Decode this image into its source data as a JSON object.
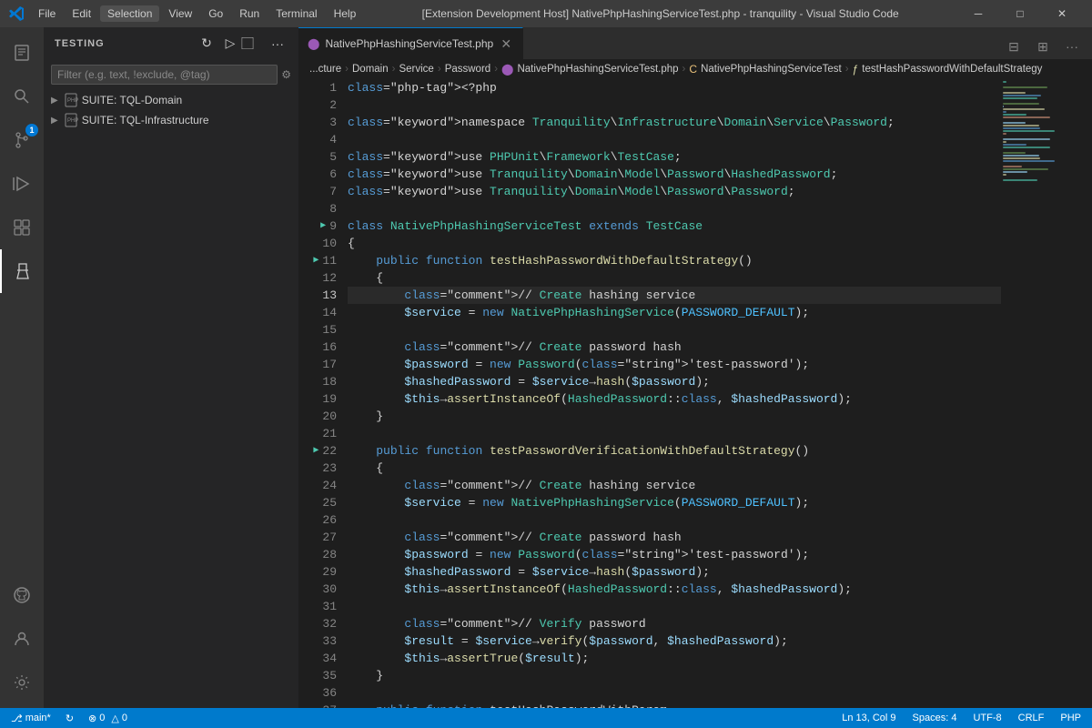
{
  "titlebar": {
    "title": "[Extension Development Host] NativePhpHashingServiceTest.php - tranquility - Visual Studio Code",
    "menu_items": [
      "File",
      "Edit",
      "Selection",
      "View",
      "Go",
      "Run",
      "Terminal",
      "Help"
    ],
    "controls": [
      "─",
      "□",
      "✕"
    ]
  },
  "activitybar": {
    "icons": [
      {
        "name": "explorer-icon",
        "symbol": "⎘",
        "active": false
      },
      {
        "name": "search-icon",
        "symbol": "🔍",
        "active": false
      },
      {
        "name": "source-control-icon",
        "symbol": "⑂",
        "active": false,
        "badge": "1"
      },
      {
        "name": "run-icon",
        "symbol": "▷",
        "active": false
      },
      {
        "name": "extensions-icon",
        "symbol": "⊞",
        "active": false
      },
      {
        "name": "testing-icon",
        "symbol": "⚗",
        "active": true
      }
    ],
    "bottom_icons": [
      {
        "name": "github-icon",
        "symbol": "⊙"
      },
      {
        "name": "account-icon",
        "symbol": "👤"
      },
      {
        "name": "settings-icon",
        "symbol": "⚙"
      }
    ]
  },
  "sidebar": {
    "title": "TESTING",
    "actions": [
      {
        "name": "refresh-icon",
        "symbol": "↻"
      },
      {
        "name": "run-all-icon",
        "symbol": "▷"
      },
      {
        "name": "cancel-icon",
        "symbol": "⃞"
      },
      {
        "name": "more-icon",
        "symbol": "···"
      }
    ],
    "filter": {
      "placeholder": "Filter (e.g. text, !exclude, @tag)"
    },
    "suites": [
      {
        "label": "SUITE: TQL-Domain"
      },
      {
        "label": "SUITE: TQL-Infrastructure"
      }
    ]
  },
  "tabbar": {
    "tabs": [
      {
        "label": "NativePhpHashingServiceTest.php",
        "icon": "●",
        "active": true
      }
    ]
  },
  "breadcrumb": {
    "items": [
      {
        "text": "...cture",
        "type": "folder"
      },
      {
        "text": "Domain",
        "type": "folder"
      },
      {
        "text": "Service",
        "type": "folder"
      },
      {
        "text": "Password",
        "type": "folder"
      },
      {
        "text": "NativePhpHashingServiceTest.php",
        "type": "php"
      },
      {
        "text": "NativePhpHashingServiceTest",
        "type": "class"
      },
      {
        "text": "testHashPasswordWithDefaultStrategy",
        "type": "method"
      }
    ]
  },
  "code": {
    "lines": [
      {
        "num": 1,
        "text": "<?php",
        "run": false
      },
      {
        "num": 2,
        "text": "",
        "run": false
      },
      {
        "num": 3,
        "text": "namespace Tranquility\\Infrastructure\\Domain\\Service\\Password;",
        "run": false
      },
      {
        "num": 4,
        "text": "",
        "run": false
      },
      {
        "num": 5,
        "text": "use PHPUnit\\Framework\\TestCase;",
        "run": false
      },
      {
        "num": 6,
        "text": "use Tranquility\\Domain\\Model\\Password\\HashedPassword;",
        "run": false
      },
      {
        "num": 7,
        "text": "use Tranquility\\Domain\\Model\\Password\\Password;",
        "run": false
      },
      {
        "num": 8,
        "text": "",
        "run": false
      },
      {
        "num": 9,
        "text": "class NativePhpHashingServiceTest extends TestCase",
        "run": true
      },
      {
        "num": 10,
        "text": "{",
        "run": false
      },
      {
        "num": 11,
        "text": "    public function testHashPasswordWithDefaultStrategy()",
        "run": true
      },
      {
        "num": 12,
        "text": "    {",
        "run": false
      },
      {
        "num": 13,
        "text": "        // Create hashing service",
        "run": false,
        "active": true
      },
      {
        "num": 14,
        "text": "        $service = new NativePhpHashingService(PASSWORD_DEFAULT);",
        "run": false
      },
      {
        "num": 15,
        "text": "",
        "run": false
      },
      {
        "num": 16,
        "text": "        // Create password hash",
        "run": false
      },
      {
        "num": 17,
        "text": "        $password = new Password('test-password');",
        "run": false
      },
      {
        "num": 18,
        "text": "        $hashedPassword = $service→hash($password);",
        "run": false
      },
      {
        "num": 19,
        "text": "        $this→assertInstanceOf(HashedPassword::class, $hashedPassword);",
        "run": false
      },
      {
        "num": 20,
        "text": "    }",
        "run": false
      },
      {
        "num": 21,
        "text": "",
        "run": false
      },
      {
        "num": 22,
        "text": "    public function testPasswordVerificationWithDefaultStrategy()",
        "run": true
      },
      {
        "num": 23,
        "text": "    {",
        "run": false
      },
      {
        "num": 24,
        "text": "        // Create hashing service",
        "run": false
      },
      {
        "num": 25,
        "text": "        $service = new NativePhpHashingService(PASSWORD_DEFAULT);",
        "run": false
      },
      {
        "num": 26,
        "text": "",
        "run": false
      },
      {
        "num": 27,
        "text": "        // Create password hash",
        "run": false
      },
      {
        "num": 28,
        "text": "        $password = new Password('test-password');",
        "run": false
      },
      {
        "num": 29,
        "text": "        $hashedPassword = $service→hash($password);",
        "run": false
      },
      {
        "num": 30,
        "text": "        $this→assertInstanceOf(HashedPassword::class, $hashedPassword);",
        "run": false
      },
      {
        "num": 31,
        "text": "",
        "run": false
      },
      {
        "num": 32,
        "text": "        // Verify password",
        "run": false
      },
      {
        "num": 33,
        "text": "        $result = $service→verify($password, $hashedPassword);",
        "run": false
      },
      {
        "num": 34,
        "text": "        $this→assertTrue($result);",
        "run": false
      },
      {
        "num": 35,
        "text": "    }",
        "run": false
      },
      {
        "num": 36,
        "text": "",
        "run": false
      },
      {
        "num": 37,
        "text": "    public function testHashPasswordWithParam...",
        "run": false
      }
    ]
  },
  "statusbar": {
    "left": [
      {
        "text": "⎇ main*"
      },
      {
        "text": "↻"
      },
      {
        "text": "⊗ 0  △ 0"
      }
    ],
    "right": [
      {
        "text": "Ln 13, Col 9"
      },
      {
        "text": "Spaces: 4"
      },
      {
        "text": "UTF-8"
      },
      {
        "text": "CRLF"
      },
      {
        "text": "PHP"
      }
    ]
  }
}
